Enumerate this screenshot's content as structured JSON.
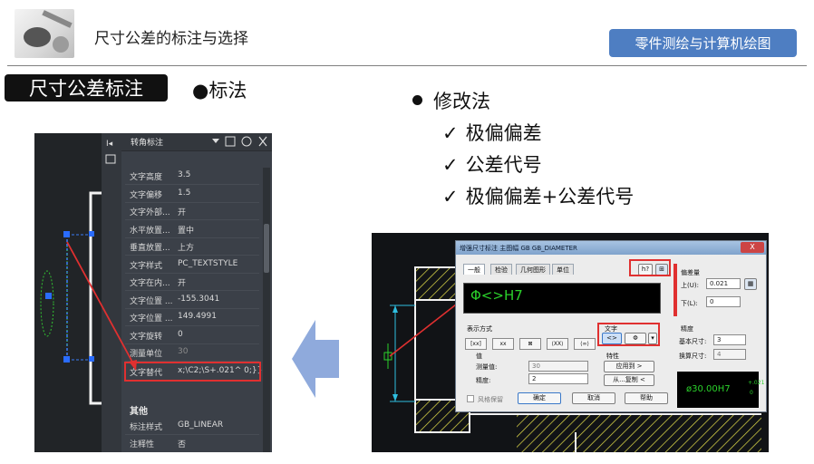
{
  "header": {
    "title": "尺寸公差的标注与选择",
    "badge": "零件测绘与计算机绘图"
  },
  "section": {
    "tag": "尺寸公差标注",
    "bullet_label": "●标法"
  },
  "modify": {
    "title": "修改法",
    "methods": [
      {
        "check": "✓",
        "label": "极偏偏差"
      },
      {
        "check": "✓",
        "label": "公差代号"
      },
      {
        "check": "✓",
        "label": "极偏偏差+公差代号"
      }
    ]
  },
  "properties_panel": {
    "header_label": "转角标注",
    "rows": [
      {
        "key": "文字高度",
        "value": "3.5"
      },
      {
        "key": "文字偏移",
        "value": "1.5"
      },
      {
        "key": "文字外部...",
        "value": "开"
      },
      {
        "key": "水平放置...",
        "value": "置中"
      },
      {
        "key": "垂直放置...",
        "value": "上方"
      },
      {
        "key": "文字样式",
        "value": "PC_TEXTSTYLE"
      },
      {
        "key": "文字在内...",
        "value": "开"
      },
      {
        "key": "文字位置 ...",
        "value": "-155.3041"
      },
      {
        "key": "文字位置 ...",
        "value": "149.4991"
      },
      {
        "key": "文字旋转",
        "value": "0"
      },
      {
        "key": "测量单位",
        "value": "30"
      },
      {
        "key": "文字替代",
        "value": "x;\\C2;\\S+.021^ 0;}}"
      }
    ],
    "group2_title": "其他",
    "group2_rows": [
      {
        "key": "标注样式",
        "value": "GB_LINEAR"
      },
      {
        "key": "注释性",
        "value": "否"
      }
    ]
  },
  "dialog": {
    "title": "增强尺寸标注 主图幅 GB GB_DIAMETER",
    "close": "X",
    "tabs": [
      "一般",
      "检验",
      "几何图形",
      "单位"
    ],
    "editor_text": "Φ<>H7",
    "format_label": "表示方式",
    "format_buttons": [
      "[xx]",
      "xx",
      "⊠",
      "⟨XX⟩",
      "⟨∞⟩"
    ],
    "text_label": "文字",
    "text_buttons": [
      "<>",
      "Φ",
      "▾"
    ],
    "value_label": "值",
    "measured_label": "测量值:",
    "measured_value": "30",
    "precision_label": "精度:",
    "precision_value": "2",
    "feature_label": "特性",
    "apply_button": "应用到 >",
    "from_button": "从...复制 <",
    "deviation_label": "偏差量",
    "upper_label": "上(U):",
    "upper_value": "0.021",
    "lower_label": "下(L):",
    "lower_value": "0",
    "precision_group": "精度",
    "base_label": "基本尺寸:",
    "base_value": "3",
    "tol_label": "换算尺寸:",
    "tol_value": "4",
    "top_buttons": [
      "h?",
      "⊞"
    ],
    "style_check_label": "风格保留",
    "ok_button": "确定",
    "cancel_button": "取消",
    "help_button": "帮助",
    "preview_text": "ø30.00H7",
    "preview_sup": "+.021",
    "preview_sub": "0"
  },
  "colors": {
    "badge": "#4e7ec2",
    "tag_bg": "#111111",
    "highlight": "#e03030",
    "arrow": "#8faadc",
    "cad_green": "#2bd22b"
  }
}
